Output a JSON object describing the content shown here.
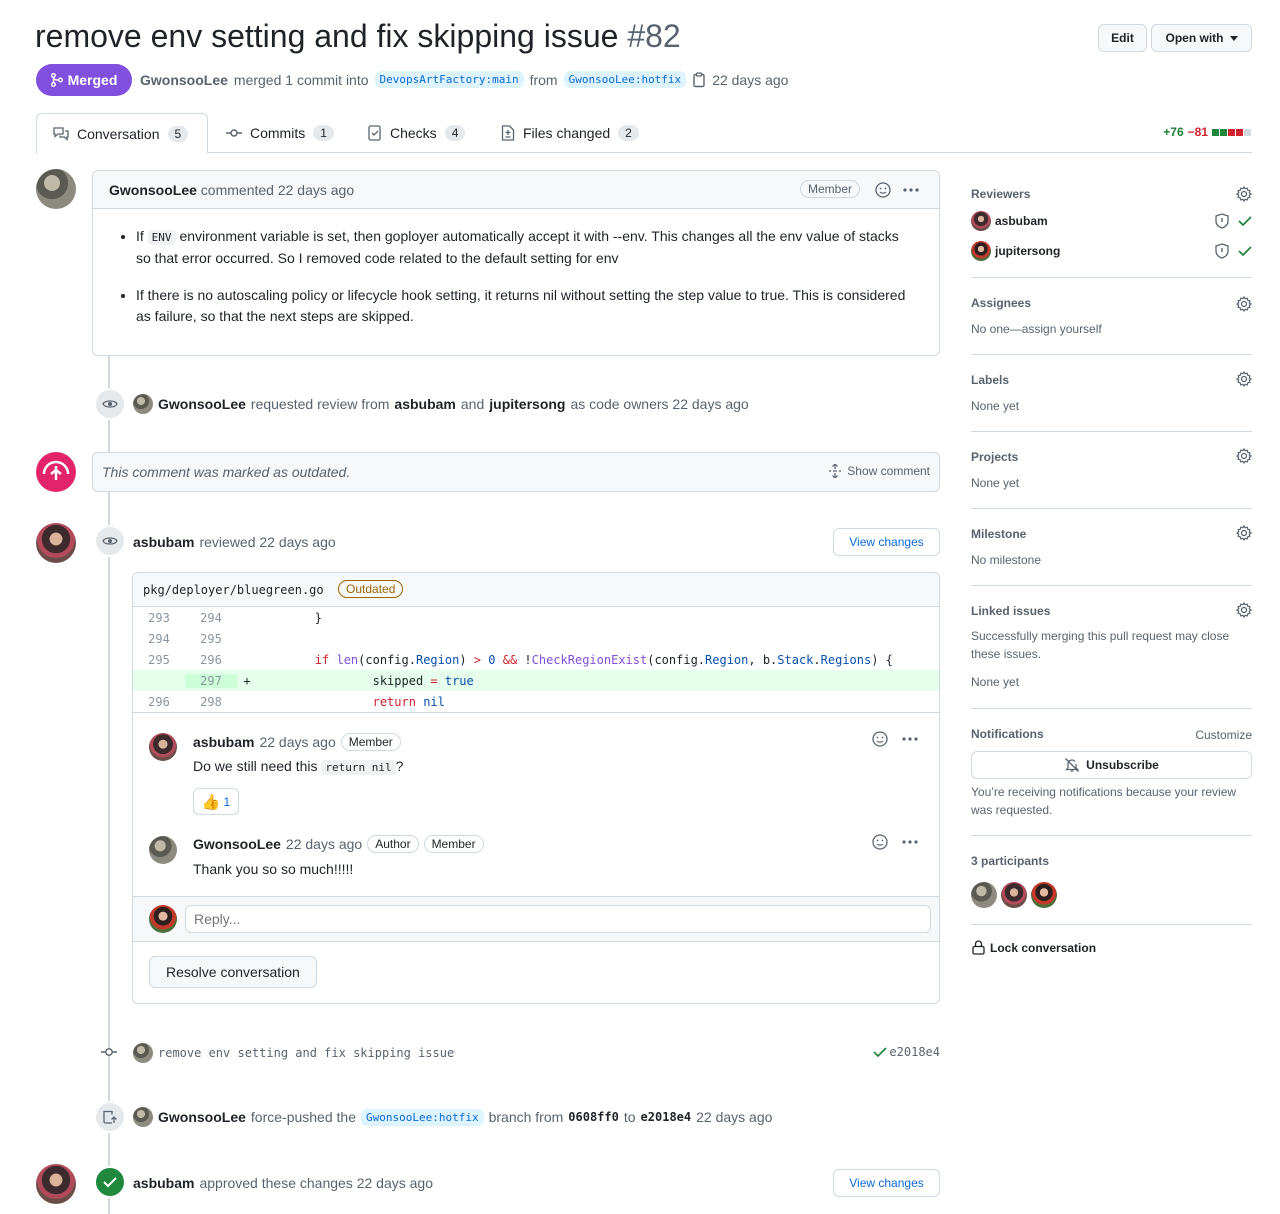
{
  "pr": {
    "title": "remove env setting and fix skipping issue",
    "number": "#82",
    "edit_label": "Edit",
    "open_with_label": "Open with",
    "state_label": "Merged",
    "author": "GwonsooLee",
    "merged_text": "merged 1 commit into",
    "base_branch": "DevopsArtFactory:main",
    "from_text": "from",
    "head_branch": "GwonsooLee:hotfix",
    "age": "22 days ago"
  },
  "tabs": [
    {
      "label": "Conversation",
      "count": "5"
    },
    {
      "label": "Commits",
      "count": "1"
    },
    {
      "label": "Checks",
      "count": "4"
    },
    {
      "label": "Files changed",
      "count": "2"
    }
  ],
  "diffstat": {
    "additions": "+76",
    "deletions": "−81",
    "colors": [
      "#1f883d",
      "#1f883d",
      "#cf222e",
      "#cf222e",
      "#d1d9e0"
    ]
  },
  "first_comment": {
    "author": "GwonsooLee",
    "action": "commented 22 days ago",
    "badge": "Member",
    "bullet1_a": "If",
    "bullet1_code": "ENV",
    "bullet1_b": "environment variable is set, then goployer automatically accept it with --env. This changes all the env value of stacks so that error occurred. So I removed code related to the default setting for env",
    "bullet2": "If there is no autoscaling policy or lifecycle hook setting, it returns nil without setting the step value to true. This is considered as failure, so that the next steps are skipped."
  },
  "review_request": {
    "actor": "GwonsooLee",
    "text1": "requested review from",
    "reviewer1": "asbubam",
    "text2": "and",
    "reviewer2": "jupitersong",
    "text3": "as code owners 22 days ago"
  },
  "outdated": {
    "text": "This comment was marked as outdated.",
    "show_label": "Show comment"
  },
  "review": {
    "author": "asbubam",
    "action": "reviewed 22 days ago",
    "view_changes": "View changes",
    "file": "pkg/deployer/bluegreen.go",
    "outdated_badge": "Outdated",
    "diff": [
      {
        "old": "293",
        "new": "294",
        "sign": "",
        "code": "        }",
        "added": false
      },
      {
        "old": "294",
        "new": "295",
        "sign": "",
        "code": "",
        "added": false
      },
      {
        "old": "295",
        "new": "296",
        "sign": "",
        "code": "        if len(config.Region) > 0 && !CheckRegionExist(config.Region, b.Stack.Regions) {",
        "added": false
      },
      {
        "old": "",
        "new": "297",
        "sign": "+",
        "code": "                skipped = true",
        "added": true
      },
      {
        "old": "296",
        "new": "298",
        "sign": "",
        "code": "                return nil",
        "added": false
      }
    ],
    "c1_author": "asbubam",
    "c1_time": "22 days ago",
    "c1_badge": "Member",
    "c1_text_a": "Do we still need this",
    "c1_code": "return nil",
    "c1_text_b": "?",
    "c1_reaction_count": "1",
    "c2_author": "GwonsooLee",
    "c2_time": "22 days ago",
    "c2_badge1": "Author",
    "c2_badge2": "Member",
    "c2_text": "Thank you so so much!!!!!",
    "reply_placeholder": "Reply...",
    "resolve_label": "Resolve conversation"
  },
  "commit": {
    "message": "remove env setting and fix skipping issue",
    "sha": "e2018e4"
  },
  "force_push": {
    "actor": "GwonsooLee",
    "text1": "force-pushed the",
    "branch": "GwonsooLee:hotfix",
    "text2": "branch from",
    "from_sha": "0608ff0",
    "text3": "to",
    "to_sha": "e2018e4",
    "text4": "22 days ago"
  },
  "approval": {
    "actor": "asbubam",
    "text": "approved these changes 22 days ago",
    "view_changes": "View changes"
  },
  "sidebar": {
    "reviewers_title": "Reviewers",
    "reviewer1": "asbubam",
    "reviewer2": "jupitersong",
    "assignees_title": "Assignees",
    "assignees_value": "No one—assign yourself",
    "labels_title": "Labels",
    "labels_value": "None yet",
    "projects_title": "Projects",
    "projects_value": "None yet",
    "milestone_title": "Milestone",
    "milestone_value": "No milestone",
    "linked_title": "Linked issues",
    "linked_desc": "Successfully merging this pull request may close these issues.",
    "linked_value": "None yet",
    "notif_title": "Notifications",
    "notif_customize": "Customize",
    "unsubscribe": "Unsubscribe",
    "notif_desc": "You’re receiving notifications because your review was requested.",
    "participants_title": "3 participants",
    "lock_label": "Lock conversation"
  }
}
